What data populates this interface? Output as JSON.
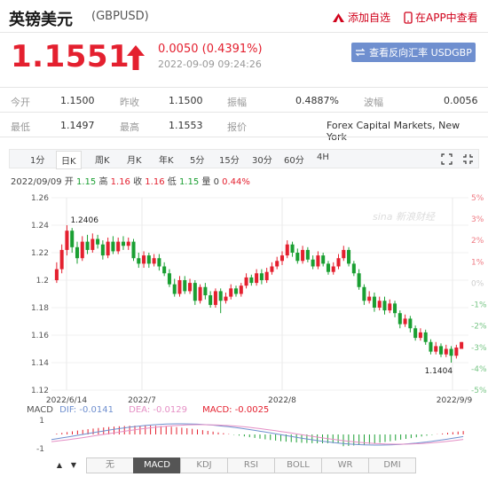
{
  "header": {
    "title": "英镑美元",
    "code": "(GBPUSD)",
    "add_fav": "添加自选",
    "app_view": "在APP中查看"
  },
  "quote": {
    "price": "1.1551",
    "change": "0.0050 (0.4391%)",
    "time": "2022-09-09 09:24:26",
    "reverse_button": "查看反向汇率 USDGBP"
  },
  "stats": {
    "row1": [
      {
        "label": "今开",
        "value": "1.1500"
      },
      {
        "label": "昨收",
        "value": "1.1500"
      },
      {
        "label": "振幅",
        "value": "0.4887%"
      },
      {
        "label": "波幅",
        "value": "0.0056"
      }
    ],
    "row2": [
      {
        "label": "最低",
        "value": "1.1497"
      },
      {
        "label": "最高",
        "value": "1.1553"
      },
      {
        "label": "报价",
        "value": "Forex Capital Markets, New York"
      }
    ]
  },
  "tabs": [
    "1分",
    "日K",
    "周K",
    "月K",
    "年K",
    "5分",
    "15分",
    "30分",
    "60分",
    "4H"
  ],
  "active_tab": "日K",
  "ohlc": {
    "date": "2022/09/09",
    "open_label": "开",
    "open": "1.15",
    "high_label": "高",
    "high": "1.16",
    "close_label": "收",
    "close": "1.16",
    "low_label": "低",
    "low": "1.15",
    "vol_label": "量",
    "vol": "0",
    "pct": "0.44%"
  },
  "watermark": "sina 新浪财经",
  "macd": {
    "name": "MACD",
    "dif": "DIF: -0.0141",
    "dea": "DEA: -0.0129",
    "macd": "MACD: -0.0025",
    "y_labels": [
      "1",
      "-1"
    ]
  },
  "bottom_tabs": [
    "无",
    "MACD",
    "KDJ",
    "RSI",
    "BOLL",
    "WR",
    "DMI"
  ],
  "active_bottom_tab": "MACD",
  "colors": {
    "up": "#e4202f",
    "down": "#1a9f32",
    "accent": "#6f8fcf"
  },
  "chart_data": {
    "type": "candlestick",
    "y_ticks": [
      "1.26",
      "1.24",
      "1.22",
      "1.2",
      "1.18",
      "1.16",
      "1.14",
      "1.12"
    ],
    "ylim": [
      1.12,
      1.26
    ],
    "pct_ticks": [
      "5%",
      "3%",
      "2%",
      "1%",
      "0%",
      "-1%",
      "-2%",
      "-3%",
      "-4%",
      "-5%"
    ],
    "x_labels": [
      "2022/6/14",
      "2022/7",
      "2022/8",
      "2022/9/9"
    ],
    "annotations": {
      "max": "1.2406",
      "min": "1.1404"
    },
    "candles": [
      [
        1.2,
        1.208,
        1.213,
        1.198
      ],
      [
        1.208,
        1.222,
        1.226,
        1.205
      ],
      [
        1.222,
        1.236,
        1.24,
        1.218
      ],
      [
        1.236,
        1.224,
        1.238,
        1.22
      ],
      [
        1.224,
        1.216,
        1.228,
        1.212
      ],
      [
        1.216,
        1.228,
        1.232,
        1.214
      ],
      [
        1.228,
        1.222,
        1.233,
        1.219
      ],
      [
        1.222,
        1.23,
        1.234,
        1.22
      ],
      [
        1.23,
        1.226,
        1.233,
        1.223
      ],
      [
        1.226,
        1.218,
        1.229,
        1.215
      ],
      [
        1.218,
        1.228,
        1.231,
        1.216
      ],
      [
        1.228,
        1.221,
        1.232,
        1.219
      ],
      [
        1.221,
        1.228,
        1.231,
        1.219
      ],
      [
        1.228,
        1.225,
        1.232,
        1.222
      ],
      [
        1.225,
        1.228,
        1.231,
        1.222
      ],
      [
        1.228,
        1.216,
        1.23,
        1.214
      ],
      [
        1.216,
        1.212,
        1.22,
        1.209
      ],
      [
        1.212,
        1.218,
        1.221,
        1.209
      ],
      [
        1.218,
        1.212,
        1.22,
        1.209
      ],
      [
        1.212,
        1.216,
        1.219,
        1.21
      ],
      [
        1.216,
        1.21,
        1.219,
        1.207
      ],
      [
        1.21,
        1.205,
        1.213,
        1.203
      ],
      [
        1.205,
        1.197,
        1.208,
        1.195
      ],
      [
        1.197,
        1.19,
        1.201,
        1.188
      ],
      [
        1.19,
        1.2,
        1.203,
        1.188
      ],
      [
        1.2,
        1.192,
        1.203,
        1.19
      ],
      [
        1.192,
        1.198,
        1.201,
        1.19
      ],
      [
        1.198,
        1.185,
        1.2,
        1.182
      ],
      [
        1.185,
        1.195,
        1.197,
        1.183
      ],
      [
        1.195,
        1.189,
        1.198,
        1.186
      ],
      [
        1.189,
        1.182,
        1.192,
        1.18
      ],
      [
        1.182,
        1.192,
        1.194,
        1.18
      ],
      [
        1.192,
        1.185,
        1.194,
        1.176
      ],
      [
        1.185,
        1.188,
        1.191,
        1.183
      ],
      [
        1.188,
        1.194,
        1.197,
        1.186
      ],
      [
        1.194,
        1.19,
        1.196,
        1.188
      ],
      [
        1.19,
        1.196,
        1.198,
        1.188
      ],
      [
        1.196,
        1.202,
        1.205,
        1.194
      ],
      [
        1.202,
        1.198,
        1.204,
        1.196
      ],
      [
        1.198,
        1.205,
        1.208,
        1.196
      ],
      [
        1.205,
        1.2,
        1.208,
        1.197
      ],
      [
        1.2,
        1.206,
        1.209,
        1.198
      ],
      [
        1.206,
        1.21,
        1.213,
        1.204
      ],
      [
        1.21,
        1.214,
        1.217,
        1.208
      ],
      [
        1.214,
        1.218,
        1.221,
        1.211
      ],
      [
        1.218,
        1.226,
        1.229,
        1.216
      ],
      [
        1.226,
        1.22,
        1.228,
        1.217
      ],
      [
        1.22,
        1.214,
        1.223,
        1.212
      ],
      [
        1.214,
        1.222,
        1.225,
        1.212
      ],
      [
        1.222,
        1.215,
        1.224,
        1.213
      ],
      [
        1.215,
        1.21,
        1.218,
        1.208
      ],
      [
        1.21,
        1.218,
        1.221,
        1.208
      ],
      [
        1.218,
        1.212,
        1.22,
        1.21
      ],
      [
        1.212,
        1.206,
        1.214,
        1.204
      ],
      [
        1.206,
        1.21,
        1.213,
        1.204
      ],
      [
        1.21,
        1.216,
        1.219,
        1.208
      ],
      [
        1.216,
        1.222,
        1.225,
        1.214
      ],
      [
        1.222,
        1.212,
        1.224,
        1.21
      ],
      [
        1.212,
        1.205,
        1.214,
        1.203
      ],
      [
        1.205,
        1.195,
        1.208,
        1.193
      ],
      [
        1.195,
        1.185,
        1.197,
        1.182
      ],
      [
        1.185,
        1.188,
        1.192,
        1.183
      ],
      [
        1.188,
        1.18,
        1.191,
        1.177
      ],
      [
        1.18,
        1.185,
        1.188,
        1.178
      ],
      [
        1.185,
        1.178,
        1.188,
        1.175
      ],
      [
        1.178,
        1.183,
        1.186,
        1.176
      ],
      [
        1.183,
        1.176,
        1.185,
        1.173
      ],
      [
        1.176,
        1.168,
        1.178,
        1.165
      ],
      [
        1.168,
        1.172,
        1.175,
        1.166
      ],
      [
        1.172,
        1.165,
        1.174,
        1.162
      ],
      [
        1.165,
        1.158,
        1.167,
        1.156
      ],
      [
        1.158,
        1.162,
        1.165,
        1.156
      ],
      [
        1.162,
        1.155,
        1.164,
        1.153
      ],
      [
        1.155,
        1.148,
        1.157,
        1.146
      ],
      [
        1.148,
        1.152,
        1.155,
        1.146
      ],
      [
        1.152,
        1.146,
        1.154,
        1.144
      ],
      [
        1.146,
        1.15,
        1.153,
        1.144
      ],
      [
        1.15,
        1.145,
        1.152,
        1.14
      ],
      [
        1.145,
        1.151,
        1.153,
        1.143
      ],
      [
        1.15,
        1.155,
        1.155,
        1.15
      ]
    ]
  }
}
